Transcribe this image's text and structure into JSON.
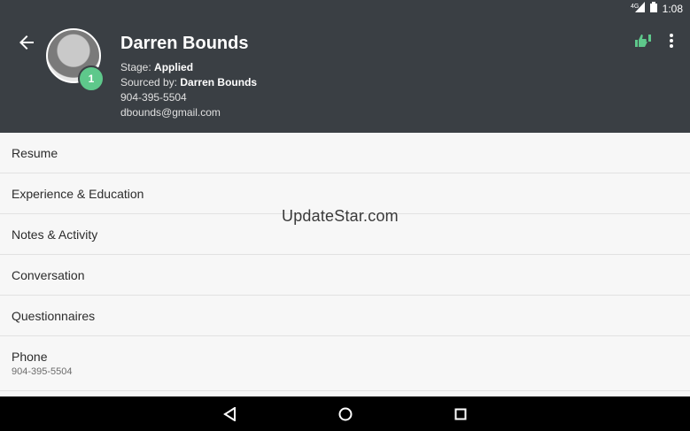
{
  "status_bar": {
    "time": "1:08",
    "network_label": "4G"
  },
  "header": {
    "name": "Darren Bounds",
    "badge_count": "1",
    "stage_label": "Stage:",
    "stage_value": "Applied",
    "sourced_label": "Sourced by:",
    "sourced_value": "Darren Bounds",
    "phone": "904-395-5504",
    "email": "dbounds@gmail.com",
    "accent_color": "#5ec88b",
    "background_color": "#3a3f44"
  },
  "menu": [
    {
      "label": "Resume"
    },
    {
      "label": "Experience & Education"
    },
    {
      "label": "Notes & Activity"
    },
    {
      "label": "Conversation"
    },
    {
      "label": "Questionnaires"
    },
    {
      "label": "Phone",
      "sublabel": "904-395-5504"
    }
  ],
  "watermark": "UpdateStar.com",
  "icons": {
    "back": "arrow-left-icon",
    "thumbs": "thumbs-up-down-icon",
    "more": "more-vertical-icon",
    "nav_back": "triangle-back-icon",
    "nav_home": "circle-home-icon",
    "nav_recents": "square-recents-icon"
  }
}
